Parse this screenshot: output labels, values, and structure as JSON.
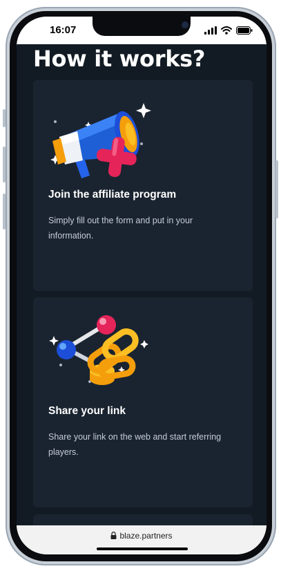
{
  "status": {
    "time": "16:07"
  },
  "page": {
    "title": "How it works?"
  },
  "cards": [
    {
      "title": "Join the affiliate program",
      "description": "Simply fill out the form and put in your information.",
      "icon": "megaphone-plus-icon"
    },
    {
      "title": "Share your link",
      "description": "Share your link on the web and start referring players.",
      "icon": "chain-link-icon"
    }
  ],
  "browser": {
    "url": "blaze.partners"
  },
  "colors": {
    "background": "#121b24",
    "card": "#1a2430",
    "accent": "#e9274a"
  }
}
